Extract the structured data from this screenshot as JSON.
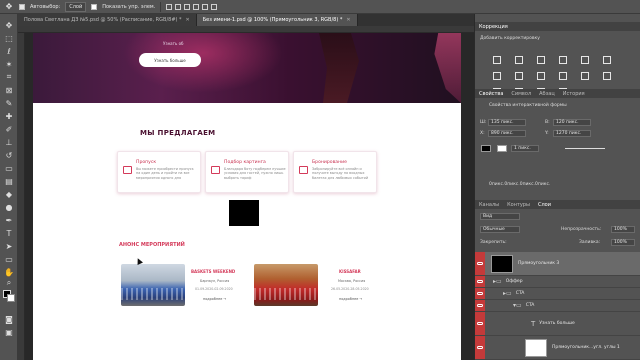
{
  "option_bar": {
    "auto_select_label": "Автовыбор:",
    "auto_select_value": "Слой",
    "show_transform_label": "Показать упр. элем."
  },
  "tabs": [
    {
      "label": "Полова Светлана  ДЗ №5.psd @ 50% (Расписание, RGB/8#) *"
    },
    {
      "label": "Без имени-1.psd @ 100% (Прямоугольник 3, RGB/8) *"
    }
  ],
  "document": {
    "hero_small_text": "Узнать об",
    "hero_button": "Узнать больше",
    "offer_title": "МЫ ПРЕДЛАГАЕМ",
    "cards": [
      {
        "title": "Пропуск",
        "text": "Вы можете приобрести пропуск на один день и пройти на все мероприятия одного дня"
      },
      {
        "title": "Подбор картинга",
        "text": "Благодаря боту подберем лучшие условия для гостей, нужно лишь выбрать тариф"
      },
      {
        "title": "Бронирование",
        "text": "Забронируйте всё онлайн и получите выгоду на входных билетах для любимых событий"
      }
    ],
    "events_title": "АНОНС МЕРОПРИЯТИЙ",
    "events": [
      {
        "title": "BASKETS WEEKEND",
        "sub": "Барнаул, Россия",
        "date": "01.09.2020-02.09.2020",
        "more": "подробнее  →"
      },
      {
        "title": "KISSAFAR",
        "sub": "Москва, Россия",
        "date": "26.05.2020-28.05.2020",
        "more": "подробнее  →"
      }
    ]
  },
  "panels": {
    "correction": {
      "title": "Коррекция",
      "subtitle": "Добавить корректировку"
    },
    "properties": {
      "tabs": [
        "Свойства",
        "Символ",
        "Абзац",
        "История"
      ],
      "layer_type": "Свойства интерактивной формы",
      "w_label": "Ш:",
      "w_value": "135 пикс.",
      "h_label": "В:",
      "h_value": "120 пикс.",
      "x_label": "X:",
      "x_value": "890 пикс.",
      "y_label": "Y:",
      "y_value": "1270 пикс.",
      "stroke_width": "1 пикс.",
      "corners": "0пикс.0пикс.0пикс.0пикс."
    },
    "layers": {
      "tabs": [
        "Каналы",
        "Контуры",
        "Слои"
      ],
      "kind_label": "Вид",
      "mode": "Обычные",
      "opacity_label": "Непрозрачность:",
      "opacity_value": "100%",
      "lock_label": "Закрепить:",
      "fill_label": "Заливка:",
      "fill_value": "100%",
      "rows": [
        {
          "name": "Прямоугольник 3"
        },
        {
          "name": "Оффер"
        },
        {
          "name": "CTA"
        },
        {
          "name": "CTA"
        },
        {
          "name": "Узнать больше"
        },
        {
          "name": "Прямоугольник...угл. углы 1"
        }
      ]
    }
  },
  "colors": {
    "accent": "#d43a5a",
    "title_dark": "#4a1030",
    "eye_red": "#c43a3a"
  }
}
